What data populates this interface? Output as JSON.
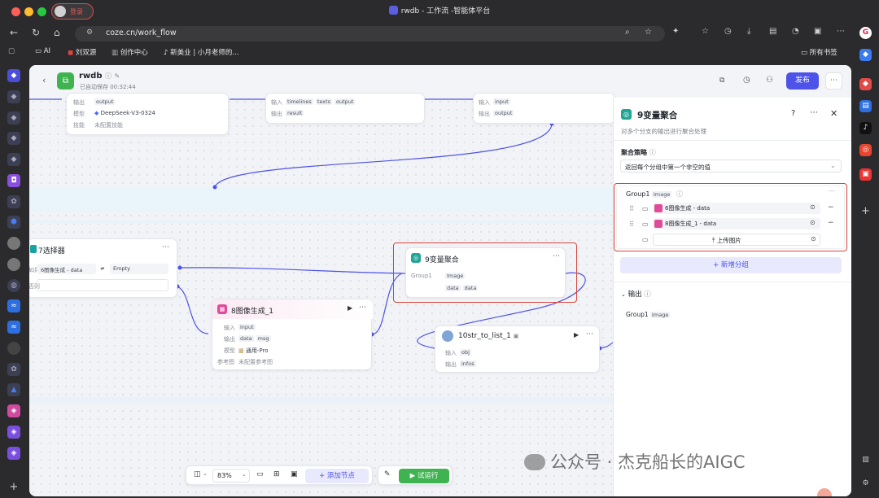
{
  "browser": {
    "window_title": "rwdb - 工作流 -智能体平台",
    "login_label": "登录",
    "url": "coze.cn/work_flow",
    "bookmarks": [
      {
        "label": "AI"
      },
      {
        "label": "刘双源"
      },
      {
        "label": "创作中心"
      },
      {
        "label": "新美业 | 小月老师的..."
      }
    ],
    "all_bookmarks": "所有书签"
  },
  "header": {
    "app_name": "rwdb",
    "autosave": "已自动保存 00:32:44",
    "publish_label": "发布"
  },
  "nodes": {
    "top1": {
      "out_label": "输出",
      "out_chip": "output",
      "model_label": "模型",
      "model_value": "DeepSeek-V3-0324",
      "skill_label": "技能",
      "skill_value": "未配置技能"
    },
    "top2": {
      "in_label": "输入",
      "in_chips": [
        "timelines",
        "texts",
        "output"
      ],
      "out_label": "输出",
      "out_chip": "result"
    },
    "top3": {
      "in_label": "输入",
      "in_chip": "input",
      "out_label": "输出",
      "out_chip": "output"
    },
    "selector": {
      "title": "7选择器",
      "if_label": "如果",
      "left_val": "6图像生成 - data",
      "op": "≠",
      "right_val": "Empty",
      "else_label": "否则"
    },
    "img8": {
      "title": "8图像生成_1",
      "in_label": "输入",
      "in_chip": "input",
      "out_label": "输出",
      "out_chips": [
        "data",
        "msg"
      ],
      "model_label": "模型",
      "model_value": "通用-Pro",
      "ref_label": "参考图",
      "ref_value": "未配置参考图"
    },
    "agg9": {
      "title": "9变量聚合",
      "group_label": "Group1",
      "group_type": "Image",
      "chips": [
        "data",
        "data"
      ]
    },
    "str10": {
      "title": "10str_to_list_1",
      "in_label": "输入",
      "in_chip": "obj",
      "out_label": "输出",
      "out_chip": "infos"
    }
  },
  "panel": {
    "title": "9变量聚合",
    "desc": "对多个分支的输出进行聚合处理",
    "strategy_label": "聚合策略",
    "strategy_value": "返回每个分组中第一个非空的值",
    "group_name": "Group1",
    "group_type": "Image",
    "items": [
      "6图像生成 - data",
      "8图像生成_1 - data"
    ],
    "upload_label": "上传图片",
    "add_group_label": "新增分组",
    "output_label": "输出",
    "output_group": "Group1",
    "output_type": "Image"
  },
  "toolbar": {
    "zoom": "83%",
    "add_node_label": "添加节点",
    "run_label": "试运行"
  },
  "watermark": "公众号 · 杰克船长的AIGC",
  "colors": {
    "accent": "#4d53e8",
    "run": "#3fb34f",
    "highlight": "#d5453b"
  }
}
